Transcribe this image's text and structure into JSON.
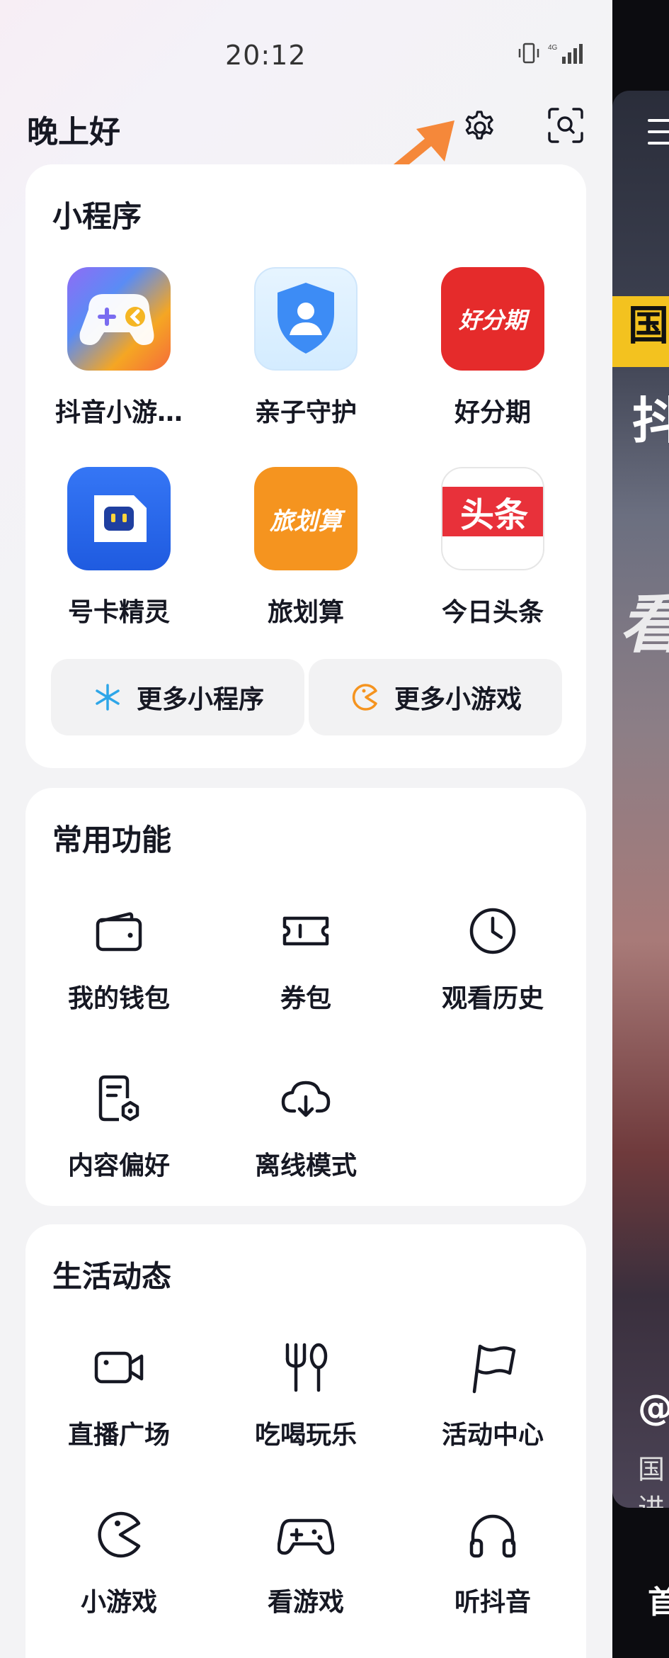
{
  "status": {
    "time": "20:12"
  },
  "header": {
    "greeting": "晚上好"
  },
  "mini_programs": {
    "title": "小程序",
    "items": [
      {
        "label": "抖音小游…",
        "icon": "game-controller-app-icon"
      },
      {
        "label": "亲子守护",
        "icon": "parent-shield-app-icon"
      },
      {
        "label": "好分期",
        "icon": "haofenqi-app-icon",
        "icon_text": "好分期"
      },
      {
        "label": "号卡精灵",
        "icon": "sim-card-app-icon"
      },
      {
        "label": "旅划算",
        "icon": "lvhuasuan-app-icon",
        "icon_text": "旅划算"
      },
      {
        "label": "今日头条",
        "icon": "toutiao-app-icon",
        "icon_text": "头条"
      }
    ],
    "more_programs": "更多小程序",
    "more_games": "更多小游戏"
  },
  "common": {
    "title": "常用功能",
    "items": [
      {
        "label": "我的钱包",
        "icon": "wallet-icon"
      },
      {
        "label": "券包",
        "icon": "ticket-icon"
      },
      {
        "label": "观看历史",
        "icon": "clock-icon"
      },
      {
        "label": "内容偏好",
        "icon": "preference-doc-icon"
      },
      {
        "label": "离线模式",
        "icon": "cloud-download-icon"
      }
    ]
  },
  "life": {
    "title": "生活动态",
    "items": [
      {
        "label": "直播广场",
        "icon": "camera-icon"
      },
      {
        "label": "吃喝玩乐",
        "icon": "fork-spoon-icon"
      },
      {
        "label": "活动中心",
        "icon": "flag-icon"
      },
      {
        "label": "小游戏",
        "icon": "pacman-icon"
      },
      {
        "label": "看游戏",
        "icon": "gamepad-icon"
      },
      {
        "label": "听抖音",
        "icon": "headphones-icon"
      }
    ]
  },
  "background_video": {
    "yellow_text": "国",
    "big_text": "抖",
    "italic_text": "看",
    "at": "@",
    "line1": "国",
    "line2": "进",
    "bottom": "首"
  },
  "colors": {
    "arrow": "#f5883a",
    "toutiao_red": "#e8313a",
    "haofenqi_red": "#e52b2b",
    "lvhuasuan_orange": "#f5941f",
    "sim_blue": "#2b6cf0"
  }
}
